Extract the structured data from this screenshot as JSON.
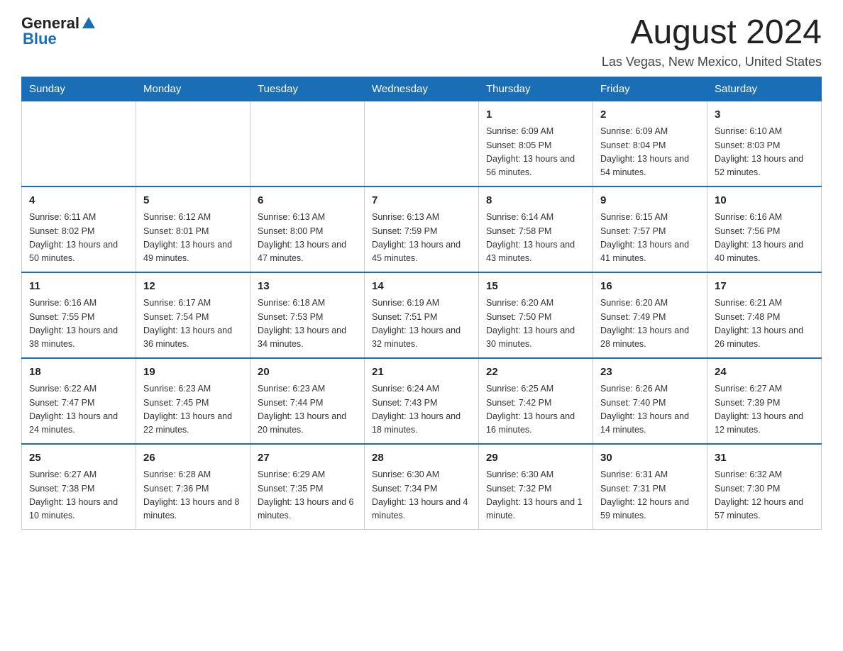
{
  "header": {
    "logo_general": "General",
    "logo_blue": "Blue",
    "month_title": "August 2024",
    "location": "Las Vegas, New Mexico, United States"
  },
  "days_of_week": [
    "Sunday",
    "Monday",
    "Tuesday",
    "Wednesday",
    "Thursday",
    "Friday",
    "Saturday"
  ],
  "weeks": [
    [
      {
        "day": "",
        "info": ""
      },
      {
        "day": "",
        "info": ""
      },
      {
        "day": "",
        "info": ""
      },
      {
        "day": "",
        "info": ""
      },
      {
        "day": "1",
        "info": "Sunrise: 6:09 AM\nSunset: 8:05 PM\nDaylight: 13 hours and 56 minutes."
      },
      {
        "day": "2",
        "info": "Sunrise: 6:09 AM\nSunset: 8:04 PM\nDaylight: 13 hours and 54 minutes."
      },
      {
        "day": "3",
        "info": "Sunrise: 6:10 AM\nSunset: 8:03 PM\nDaylight: 13 hours and 52 minutes."
      }
    ],
    [
      {
        "day": "4",
        "info": "Sunrise: 6:11 AM\nSunset: 8:02 PM\nDaylight: 13 hours and 50 minutes."
      },
      {
        "day": "5",
        "info": "Sunrise: 6:12 AM\nSunset: 8:01 PM\nDaylight: 13 hours and 49 minutes."
      },
      {
        "day": "6",
        "info": "Sunrise: 6:13 AM\nSunset: 8:00 PM\nDaylight: 13 hours and 47 minutes."
      },
      {
        "day": "7",
        "info": "Sunrise: 6:13 AM\nSunset: 7:59 PM\nDaylight: 13 hours and 45 minutes."
      },
      {
        "day": "8",
        "info": "Sunrise: 6:14 AM\nSunset: 7:58 PM\nDaylight: 13 hours and 43 minutes."
      },
      {
        "day": "9",
        "info": "Sunrise: 6:15 AM\nSunset: 7:57 PM\nDaylight: 13 hours and 41 minutes."
      },
      {
        "day": "10",
        "info": "Sunrise: 6:16 AM\nSunset: 7:56 PM\nDaylight: 13 hours and 40 minutes."
      }
    ],
    [
      {
        "day": "11",
        "info": "Sunrise: 6:16 AM\nSunset: 7:55 PM\nDaylight: 13 hours and 38 minutes."
      },
      {
        "day": "12",
        "info": "Sunrise: 6:17 AM\nSunset: 7:54 PM\nDaylight: 13 hours and 36 minutes."
      },
      {
        "day": "13",
        "info": "Sunrise: 6:18 AM\nSunset: 7:53 PM\nDaylight: 13 hours and 34 minutes."
      },
      {
        "day": "14",
        "info": "Sunrise: 6:19 AM\nSunset: 7:51 PM\nDaylight: 13 hours and 32 minutes."
      },
      {
        "day": "15",
        "info": "Sunrise: 6:20 AM\nSunset: 7:50 PM\nDaylight: 13 hours and 30 minutes."
      },
      {
        "day": "16",
        "info": "Sunrise: 6:20 AM\nSunset: 7:49 PM\nDaylight: 13 hours and 28 minutes."
      },
      {
        "day": "17",
        "info": "Sunrise: 6:21 AM\nSunset: 7:48 PM\nDaylight: 13 hours and 26 minutes."
      }
    ],
    [
      {
        "day": "18",
        "info": "Sunrise: 6:22 AM\nSunset: 7:47 PM\nDaylight: 13 hours and 24 minutes."
      },
      {
        "day": "19",
        "info": "Sunrise: 6:23 AM\nSunset: 7:45 PM\nDaylight: 13 hours and 22 minutes."
      },
      {
        "day": "20",
        "info": "Sunrise: 6:23 AM\nSunset: 7:44 PM\nDaylight: 13 hours and 20 minutes."
      },
      {
        "day": "21",
        "info": "Sunrise: 6:24 AM\nSunset: 7:43 PM\nDaylight: 13 hours and 18 minutes."
      },
      {
        "day": "22",
        "info": "Sunrise: 6:25 AM\nSunset: 7:42 PM\nDaylight: 13 hours and 16 minutes."
      },
      {
        "day": "23",
        "info": "Sunrise: 6:26 AM\nSunset: 7:40 PM\nDaylight: 13 hours and 14 minutes."
      },
      {
        "day": "24",
        "info": "Sunrise: 6:27 AM\nSunset: 7:39 PM\nDaylight: 13 hours and 12 minutes."
      }
    ],
    [
      {
        "day": "25",
        "info": "Sunrise: 6:27 AM\nSunset: 7:38 PM\nDaylight: 13 hours and 10 minutes."
      },
      {
        "day": "26",
        "info": "Sunrise: 6:28 AM\nSunset: 7:36 PM\nDaylight: 13 hours and 8 minutes."
      },
      {
        "day": "27",
        "info": "Sunrise: 6:29 AM\nSunset: 7:35 PM\nDaylight: 13 hours and 6 minutes."
      },
      {
        "day": "28",
        "info": "Sunrise: 6:30 AM\nSunset: 7:34 PM\nDaylight: 13 hours and 4 minutes."
      },
      {
        "day": "29",
        "info": "Sunrise: 6:30 AM\nSunset: 7:32 PM\nDaylight: 13 hours and 1 minute."
      },
      {
        "day": "30",
        "info": "Sunrise: 6:31 AM\nSunset: 7:31 PM\nDaylight: 12 hours and 59 minutes."
      },
      {
        "day": "31",
        "info": "Sunrise: 6:32 AM\nSunset: 7:30 PM\nDaylight: 12 hours and 57 minutes."
      }
    ]
  ]
}
